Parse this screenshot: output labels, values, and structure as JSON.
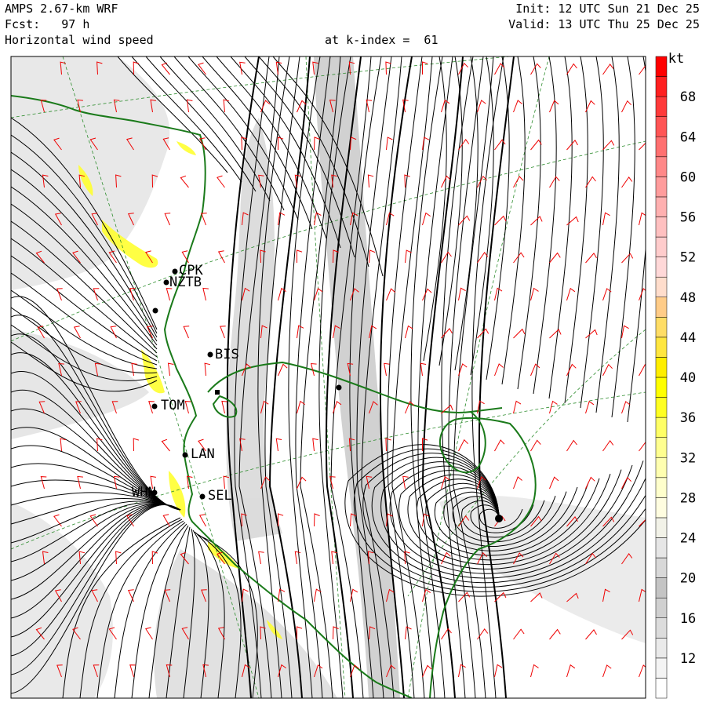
{
  "header": {
    "model": "AMPS 2.67-km WRF",
    "forecast": "Fcst:   97 h",
    "field": "Horizontal wind speed",
    "level": "at k-index =  61",
    "init": "Init: 12 UTC Sun 21 Dec 25",
    "valid": "Valid: 13 UTC Thu 25 Dec 25"
  },
  "colorbar": {
    "unit": "kt",
    "tick_labels": [
      "12",
      "16",
      "20",
      "24",
      "28",
      "32",
      "36",
      "40",
      "44",
      "48",
      "52",
      "56",
      "60",
      "64",
      "68"
    ],
    "bins": [
      {
        "from": 8,
        "to": 10,
        "color": "#ffffff"
      },
      {
        "from": 10,
        "to": 12,
        "color": "#f4f4f4"
      },
      {
        "from": 12,
        "to": 14,
        "color": "#eaeaea"
      },
      {
        "from": 14,
        "to": 16,
        "color": "#dcdcdc"
      },
      {
        "from": 16,
        "to": 18,
        "color": "#d0d0d0"
      },
      {
        "from": 18,
        "to": 20,
        "color": "#c4c4c4"
      },
      {
        "from": 20,
        "to": 22,
        "color": "#d8d8d8"
      },
      {
        "from": 22,
        "to": 24,
        "color": "#e6e6e6"
      },
      {
        "from": 24,
        "to": 26,
        "color": "#f2f2e8"
      },
      {
        "from": 26,
        "to": 28,
        "color": "#fffde0"
      },
      {
        "from": 28,
        "to": 30,
        "color": "#ffffcc"
      },
      {
        "from": 30,
        "to": 32,
        "color": "#ffffb0"
      },
      {
        "from": 32,
        "to": 34,
        "color": "#ffff90"
      },
      {
        "from": 34,
        "to": 36,
        "color": "#ffff66"
      },
      {
        "from": 36,
        "to": 38,
        "color": "#ffff22"
      },
      {
        "from": 38,
        "to": 40,
        "color": "#ffff00"
      },
      {
        "from": 40,
        "to": 42,
        "color": "#ffee00"
      },
      {
        "from": 42,
        "to": 44,
        "color": "#ffe640"
      },
      {
        "from": 44,
        "to": 46,
        "color": "#ffdd66"
      },
      {
        "from": 46,
        "to": 48,
        "color": "#ffcc88"
      },
      {
        "from": 48,
        "to": 50,
        "color": "#ffddcc"
      },
      {
        "from": 50,
        "to": 52,
        "color": "#ffd8d8"
      },
      {
        "from": 52,
        "to": 54,
        "color": "#ffcccc"
      },
      {
        "from": 54,
        "to": 56,
        "color": "#ffc0c0"
      },
      {
        "from": 56,
        "to": 58,
        "color": "#ffb0b0"
      },
      {
        "from": 58,
        "to": 60,
        "color": "#ff9c9c"
      },
      {
        "from": 60,
        "to": 62,
        "color": "#ff8888"
      },
      {
        "from": 62,
        "to": 64,
        "color": "#ff7070"
      },
      {
        "from": 64,
        "to": 66,
        "color": "#ff5555"
      },
      {
        "from": 66,
        "to": 68,
        "color": "#ff3a3a"
      },
      {
        "from": 68,
        "to": 70,
        "color": "#ff2020"
      },
      {
        "from": 70,
        "to": 72,
        "color": "#ff0000"
      }
    ]
  },
  "stations": [
    "CPK",
    "NZTB",
    "BIS",
    "TOM",
    "LAN",
    "WHN",
    "SEL"
  ],
  "colors": {
    "coastline": "#1a7a1a",
    "barb": "#ee0000",
    "streamline": "#000000",
    "grid": "#2c8c2c",
    "strong_wind": "#ffff30",
    "moderate_wind": "#c8c8c8"
  }
}
